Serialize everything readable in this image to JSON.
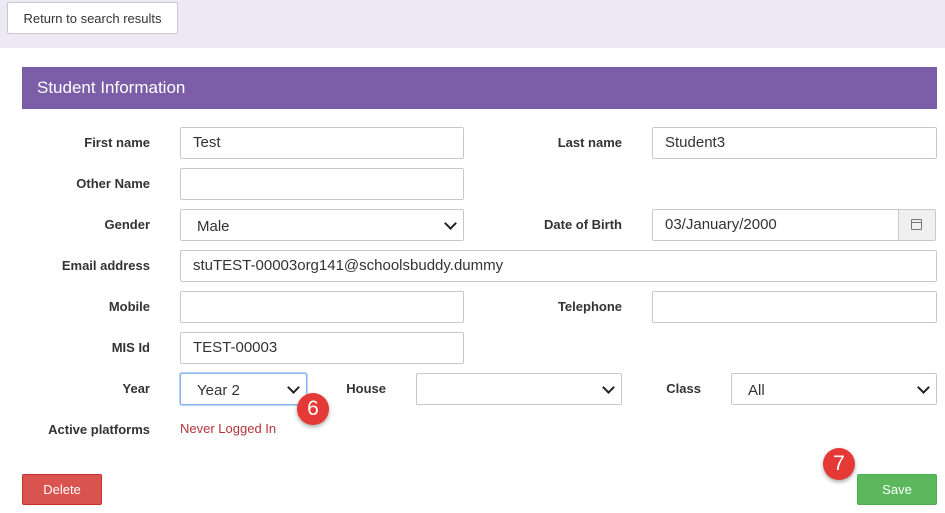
{
  "topbar": {
    "return_label": "Return to search results"
  },
  "panel": {
    "title": "Student Information"
  },
  "form": {
    "first_name": {
      "label": "First name",
      "value": "Test"
    },
    "last_name": {
      "label": "Last name",
      "value": "Student3"
    },
    "other_name": {
      "label": "Other Name",
      "value": ""
    },
    "gender": {
      "label": "Gender",
      "value": "Male"
    },
    "dob": {
      "label": "Date of Birth",
      "value": "03/January/2000",
      "icon": "calendar-icon"
    },
    "email": {
      "label": "Email address",
      "value": "stuTEST-00003org141@schoolsbuddy.dummy"
    },
    "mobile": {
      "label": "Mobile",
      "value": ""
    },
    "telephone": {
      "label": "Telephone",
      "value": ""
    },
    "mis_id": {
      "label": "MIS Id",
      "value": "TEST-00003"
    },
    "year": {
      "label": "Year",
      "value": "Year 2"
    },
    "house": {
      "label": "House",
      "value": ""
    },
    "class": {
      "label": "Class",
      "value": "All"
    },
    "active_platforms": {
      "label": "Active platforms",
      "value": "Never Logged In"
    }
  },
  "annotations": {
    "step6": "6",
    "step7": "7",
    "color": "#e53935"
  },
  "actions": {
    "delete_label": "Delete",
    "save_label": "Save"
  },
  "colors": {
    "header": "#7b5ea7",
    "delete": "#d9534f",
    "save": "#5cb85c",
    "topbar": "#ece8f4"
  }
}
